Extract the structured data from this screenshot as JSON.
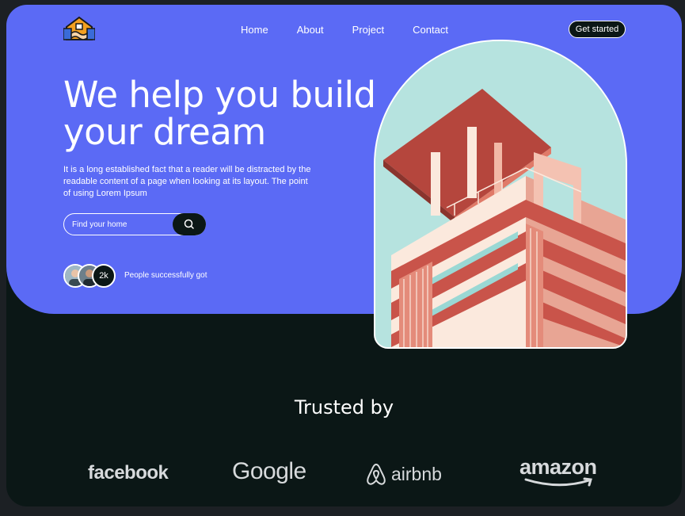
{
  "header": {
    "nav": [
      "Home",
      "About",
      "Project",
      "Contact"
    ],
    "cta_label": "Get started"
  },
  "hero": {
    "headline_line1": "We help you build",
    "headline_line2": "your dream",
    "description": "It is a long established fact that a reader will be distracted by the readable content of a page when looking at its layout. The point of using Lorem Ipsum",
    "search_placeholder": "Find your home",
    "people_count": "2k",
    "people_text": "People successfully got"
  },
  "trusted": {
    "title": "Trusted by",
    "brands": [
      "facebook",
      "Google",
      "airbnb",
      "amazon"
    ]
  },
  "colors": {
    "hero_bg": "#5b6af5",
    "page_bg": "#0b1716",
    "arch_sky": "#b6e3df",
    "building_red": "#c9544a",
    "building_cream": "#fbe9dd"
  },
  "icons": [
    "handshake-house-logo-icon",
    "search-icon",
    "airbnb-icon"
  ]
}
